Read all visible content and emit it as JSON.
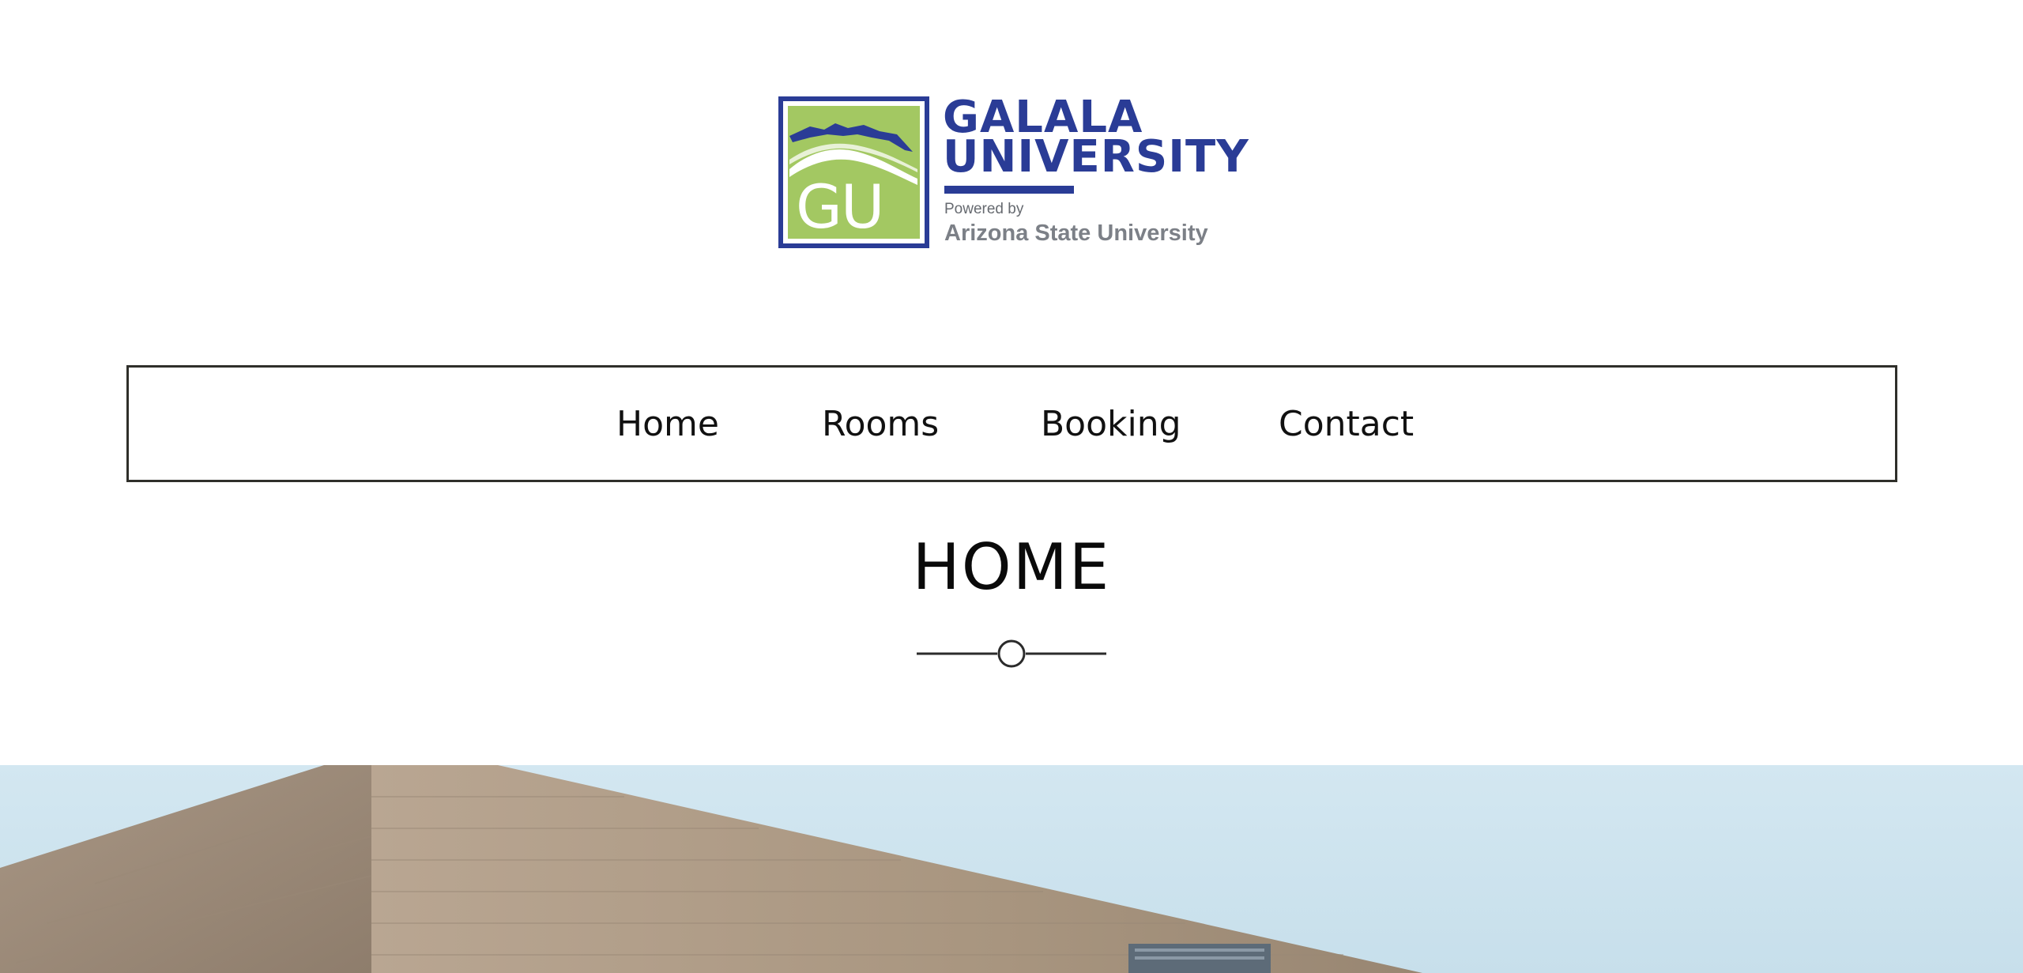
{
  "logo": {
    "line1": "GALALA",
    "line2": "UNIVERSITY",
    "powered_by": "Powered by",
    "partner": "Arizona State University",
    "mark_text": "GU"
  },
  "nav": {
    "items": [
      {
        "label": "Home"
      },
      {
        "label": "Rooms"
      },
      {
        "label": "Booking"
      },
      {
        "label": "Contact"
      }
    ]
  },
  "main": {
    "title": "HOME"
  },
  "colors": {
    "brand_blue": "#2a3c96",
    "logo_green": "#a3c862",
    "nav_border": "#2f2f2a",
    "sky": "#cfe4ee"
  },
  "icons": {
    "divider": "circle-divider-icon"
  }
}
